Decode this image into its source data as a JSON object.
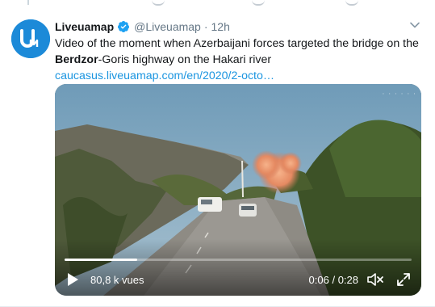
{
  "tweet": {
    "author_name": "Liveuamap",
    "author_handle": "@Liveuamap",
    "separator": "·",
    "time": "12h",
    "avatar_text": "UM",
    "text_before": "Video of the moment when Azerbaijani forces targeted the bridge on the ",
    "text_bold": "Berdzor",
    "text_after": "-Goris highway on the Hakari river ",
    "link_text": "caucasus.liveuamap.com/en/2020/2-octo…"
  },
  "video": {
    "views": "80,8 k vues",
    "time_current": "0:06",
    "time_separator": "/",
    "time_total": "0:28",
    "watermark": "· · · · · ·",
    "progress_fraction": 0.21
  },
  "colors": {
    "brand_blue": "#1da1f2",
    "link": "#1b95e0",
    "muted": "#657786"
  },
  "icons": {
    "verified": "verified-badge-icon",
    "menu": "chevron-down-icon",
    "play": "play-icon",
    "mute": "volume-muted-icon",
    "fullscreen": "fullscreen-icon"
  }
}
